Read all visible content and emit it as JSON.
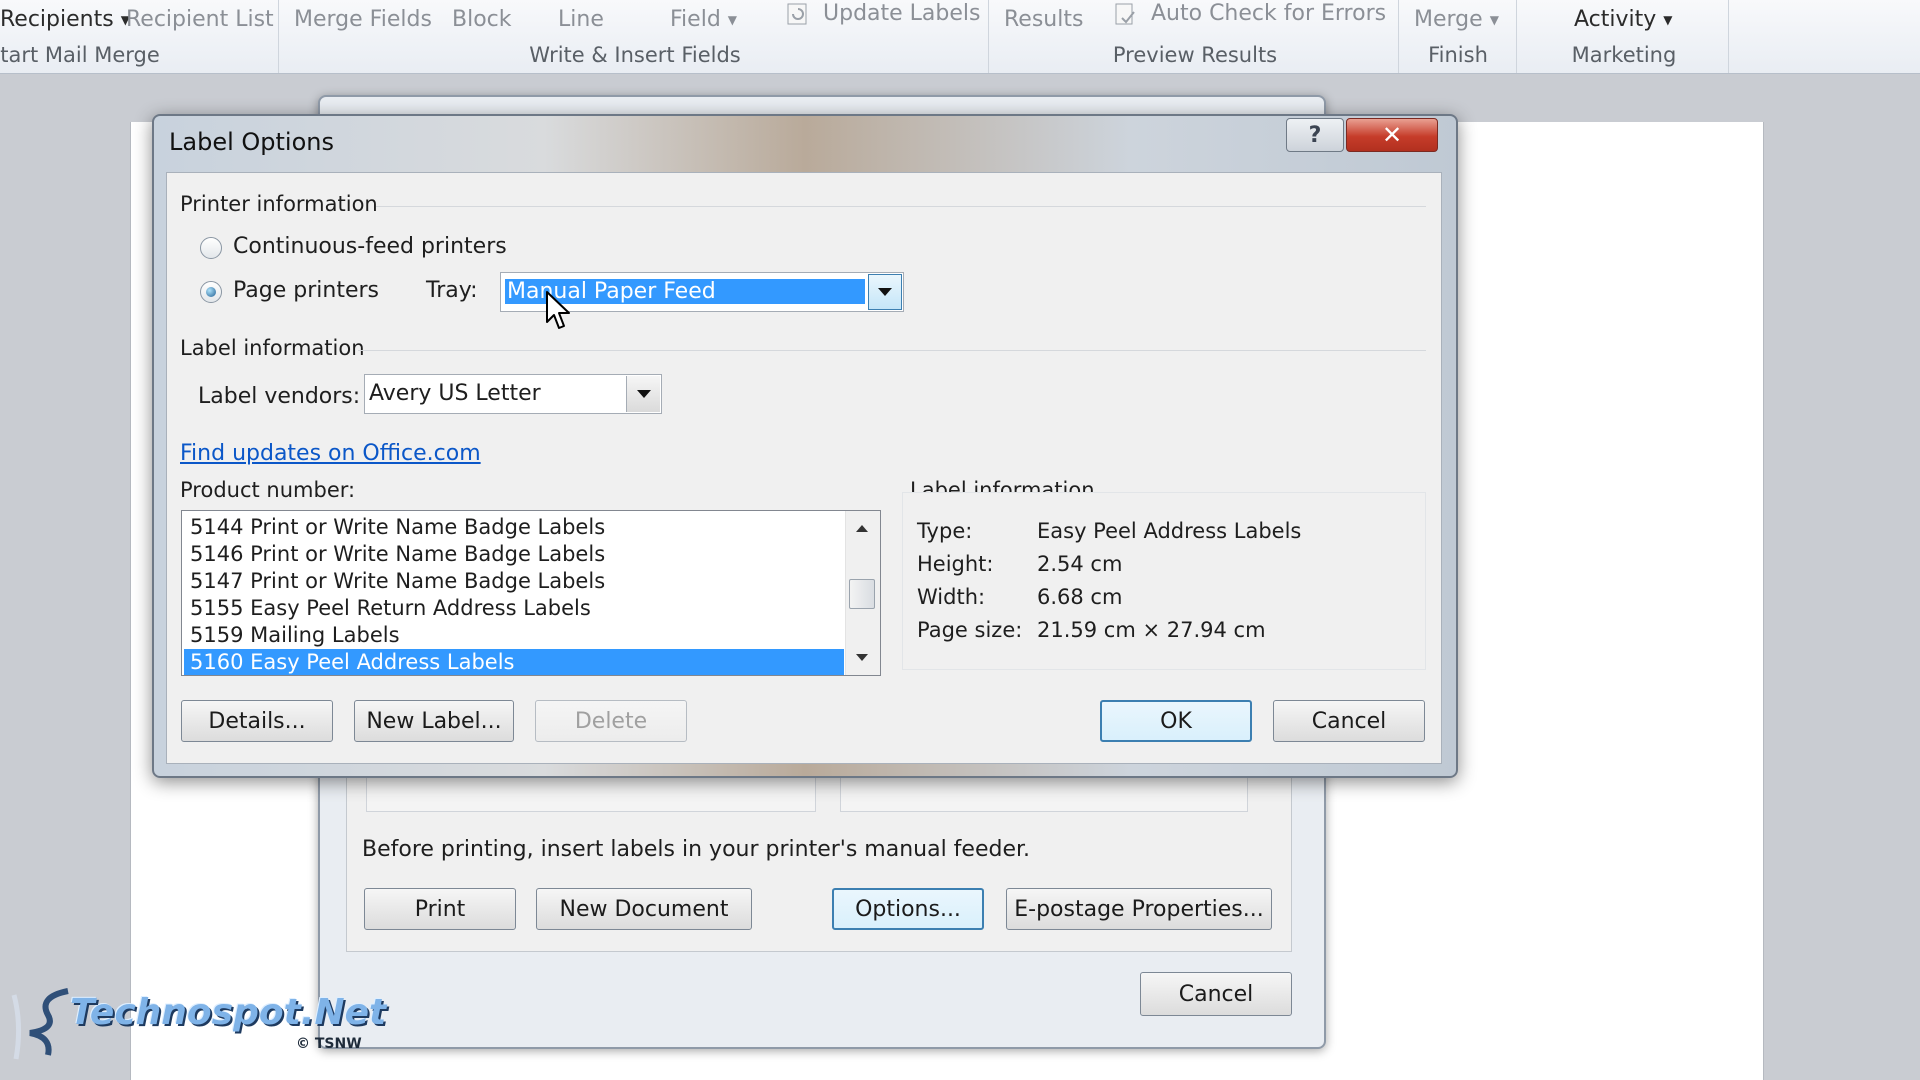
{
  "ribbon": {
    "start_group": {
      "select_recipients": "Recipients",
      "edit_recipient_list": "Recipient List",
      "label": "tart Mail Merge"
    },
    "write_group": {
      "highlight": "Merge Fields",
      "address_block": "Block",
      "greeting_line": "Line",
      "insert_merge_field": "Field",
      "update_labels": "Update Labels",
      "label": "Write & Insert Fields"
    },
    "preview_group": {
      "preview_results": "Results",
      "auto_check": "Auto Check for Errors",
      "label": "Preview Results"
    },
    "finish_group": {
      "finish_merge": "Merge",
      "label": "Finish"
    },
    "marketing_group": {
      "activity": "Activity",
      "label": "Marketing"
    }
  },
  "bg_dialog": {
    "instruction": "Before printing, insert labels in your printer's manual feeder.",
    "print_label": "Print",
    "new_document_label": "New Document",
    "options_label": "Options...",
    "epostage_label": "E-postage Properties...",
    "cancel_label": "Cancel"
  },
  "dialog": {
    "title": "Label Options",
    "help_glyph": "?",
    "close_glyph": "✕",
    "printer_info_heading": "Printer information",
    "continuous_label": "Continuous-feed printers",
    "page_printers_label": "Page printers",
    "tray_label": "Tray:",
    "tray_value": "Manual Paper Feed",
    "label_info_heading": "Label information",
    "vendors_label": "Label vendors:",
    "vendors_value": "Avery US Letter",
    "find_updates_link": "Find updates on Office.com",
    "product_number_label": "Product number:",
    "products": [
      "5144 Print or Write Name Badge Labels",
      "5146 Print or Write Name Badge Labels",
      "5147 Print or Write Name Badge Labels",
      "5155 Easy Peel Return Address Labels",
      "5159 Mailing Labels",
      "5160 Easy Peel Address Labels"
    ],
    "selected_product": "5160 Easy Peel Address Labels",
    "info_panel": {
      "heading": "Label information",
      "type_key": "Type:",
      "type_value": "Easy Peel Address Labels",
      "height_key": "Height:",
      "height_value": "2.54 cm",
      "width_key": "Width:",
      "width_value": "6.68 cm",
      "page_size_key": "Page size:",
      "page_size_value": "21.59 cm × 27.94 cm"
    },
    "details_label": "Details...",
    "new_label_label": "New Label...",
    "delete_label": "Delete",
    "ok_label": "OK",
    "cancel_label": "Cancel"
  },
  "watermark": {
    "brand": "Technospot.Net",
    "sub": "© TSNW"
  },
  "colors": {
    "selection": "#3399ff",
    "link": "#0b57c8",
    "close_button": "#c63c2a"
  }
}
